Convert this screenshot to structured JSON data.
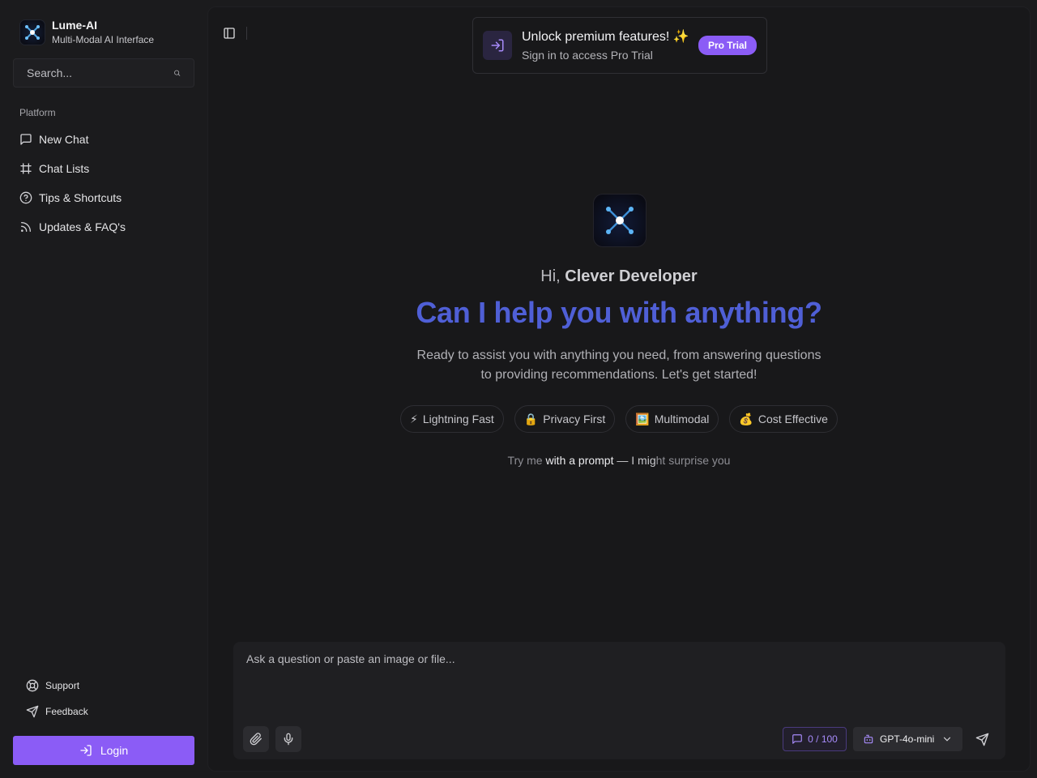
{
  "brand": {
    "name": "Lume-AI",
    "subtitle": "Multi-Modal AI Interface",
    "logo_icon": "network-icon"
  },
  "search": {
    "placeholder": "Search...",
    "value": "",
    "icon": "search-icon"
  },
  "sidebar": {
    "section_label": "Platform",
    "items": [
      {
        "label": "New Chat",
        "icon": "message-square-icon"
      },
      {
        "label": "Chat Lists",
        "icon": "hash-icon"
      },
      {
        "label": "Tips & Shortcuts",
        "icon": "help-circle-icon"
      },
      {
        "label": "Updates & FAQ's",
        "icon": "rss-icon"
      }
    ],
    "bottom": [
      {
        "label": "Support",
        "icon": "lifebuoy-icon"
      },
      {
        "label": "Feedback",
        "icon": "send-icon"
      }
    ],
    "login_label": "Login"
  },
  "promo": {
    "title": "Unlock premium features! ✨",
    "subtitle": "Sign in to access Pro Trial",
    "button": "Pro Trial"
  },
  "hero": {
    "greeting_prefix": "Hi,",
    "user_name": "Clever Developer",
    "headline": "Can I help you with anything?",
    "description": "Ready to assist you with anything you need, from answering questions to providing recommendations. Let's get started!",
    "chips": [
      {
        "emoji": "⚡",
        "label": "Lightning Fast"
      },
      {
        "emoji": "🔒",
        "label": "Privacy First"
      },
      {
        "emoji": "🖼️",
        "label": "Multimodal"
      },
      {
        "emoji": "💰",
        "label": "Cost Effective"
      }
    ],
    "prompt_hint": {
      "p1": "Try me ",
      "p2": "with a prompt",
      "p3": " — I mig",
      "p4": "ht surprise you"
    }
  },
  "composer": {
    "placeholder": "Ask a question or paste an image or file...",
    "value": "",
    "counter": "0 / 100",
    "model": "GPT-4o-mini"
  },
  "colors": {
    "accent": "#8b5cf6",
    "headline": "#4f5fd6",
    "background": "#1b1b1d",
    "panel": "#18181a"
  }
}
